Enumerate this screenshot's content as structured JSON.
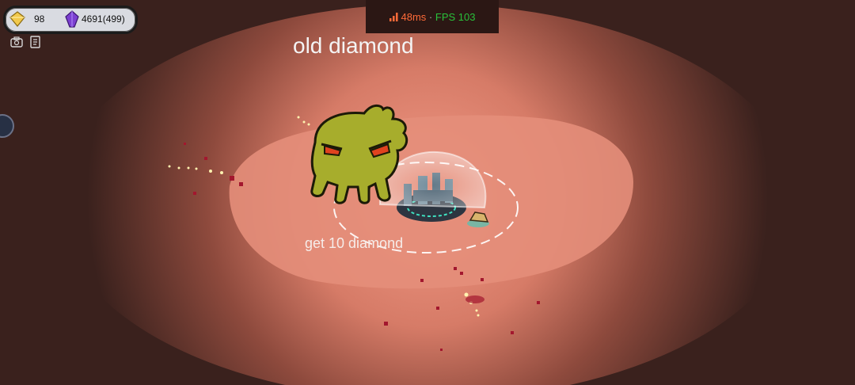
{
  "hud": {
    "gold": "98",
    "gems": "4691(499)",
    "gold_icon": "gold-diamond-icon",
    "gem_icon": "purple-gem-icon"
  },
  "network": {
    "ping": "48ms",
    "separator": "·",
    "fps": "FPS 103",
    "signal_icon": "signal-bars-icon"
  },
  "quest": {
    "title": "old diamond",
    "objective": "get 10 diamond"
  },
  "toolbar_icons": [
    "inventory-icon",
    "scroll-icon"
  ],
  "colors": {
    "ping": "#ff6a38",
    "fps": "#29c03a",
    "ground_light": "#e08a77",
    "ground_dark": "#3a211d",
    "monster": "#a7ad2c"
  }
}
